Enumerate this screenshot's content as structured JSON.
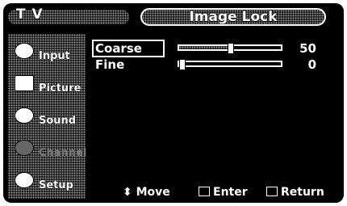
{
  "header": {
    "app_title": "T V",
    "screen_title": "Image Lock"
  },
  "sidebar": {
    "items": [
      {
        "label": "Input",
        "icon": "input-icon",
        "enabled": true
      },
      {
        "label": "Picture",
        "icon": "picture-icon",
        "enabled": true
      },
      {
        "label": "Sound",
        "icon": "sound-icon",
        "enabled": true
      },
      {
        "label": "Channel",
        "icon": "channel-icon",
        "enabled": false
      },
      {
        "label": "Setup",
        "icon": "setup-icon",
        "enabled": true
      }
    ]
  },
  "settings": [
    {
      "label": "Coarse",
      "value": "50",
      "fraction": 0.5,
      "selected": true
    },
    {
      "label": "Fine",
      "value": "0",
      "fraction": 0.0,
      "selected": false
    }
  ],
  "footer": {
    "move": "Move",
    "enter": "Enter",
    "return": "Return"
  }
}
